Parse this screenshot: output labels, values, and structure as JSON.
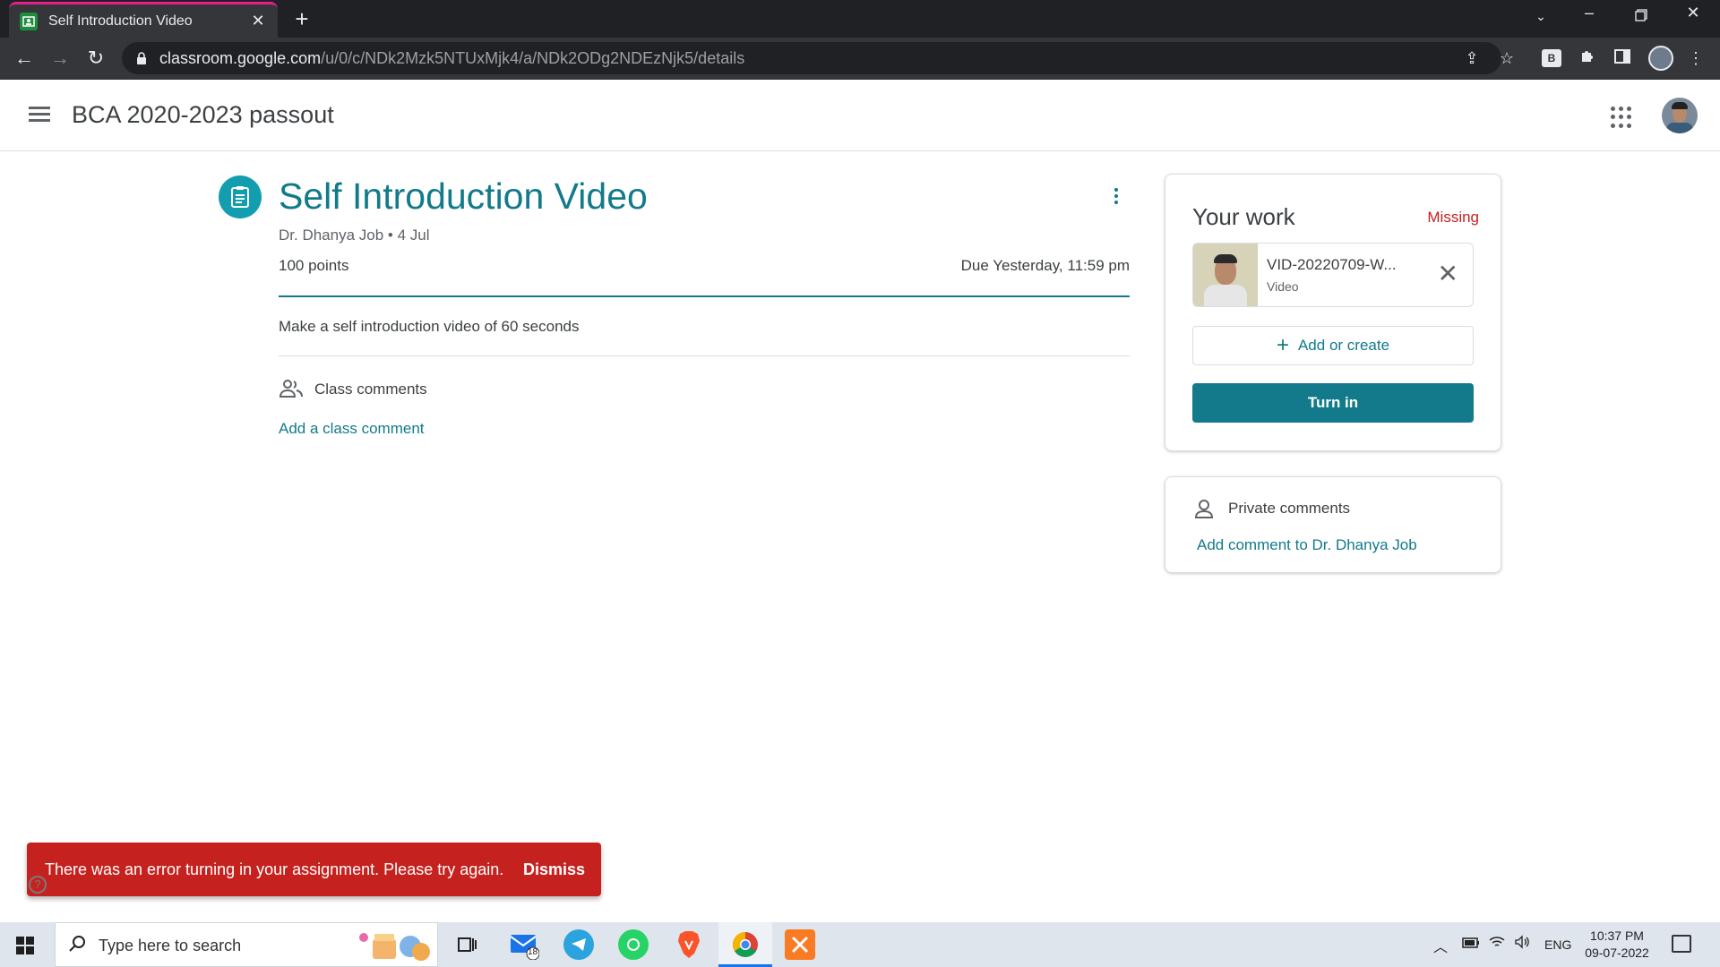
{
  "browser": {
    "tab_title": "Self Introduction Video",
    "url_host": "classroom.google.com",
    "url_path": "/u/0/c/NDk2Mzk5NTUxMjk4/a/NDk2ODg2NDEzNjk5/details",
    "extension_badge": "B"
  },
  "header": {
    "class_name": "BCA 2020-2023 passout"
  },
  "assignment": {
    "title": "Self Introduction Video",
    "meta": "Dr. Dhanya Job • 4 Jul",
    "points": "100 points",
    "due": "Due Yesterday, 11:59 pm",
    "description": "Make a self introduction video of 60 seconds",
    "class_comments_label": "Class comments",
    "add_class_comment": "Add a class comment"
  },
  "your_work": {
    "title": "Your work",
    "status": "Missing",
    "attachment_name": "VID-20220709-W...",
    "attachment_type": "Video",
    "add_or_create": "Add or create",
    "turn_in": "Turn in"
  },
  "private_comments": {
    "label": "Private comments",
    "add": "Add comment to Dr. Dhanya Job"
  },
  "snackbar": {
    "message": "There was an error turning in your assignment. Please try again.",
    "dismiss": "Dismiss"
  },
  "taskbar": {
    "search_placeholder": "Type here to search",
    "mail_badge": "18",
    "language": "ENG",
    "time": "10:37 PM",
    "date": "09-07-2022"
  },
  "colors": {
    "accent": "#127a8a",
    "error": "#c5221f",
    "missing": "#c5221f"
  }
}
